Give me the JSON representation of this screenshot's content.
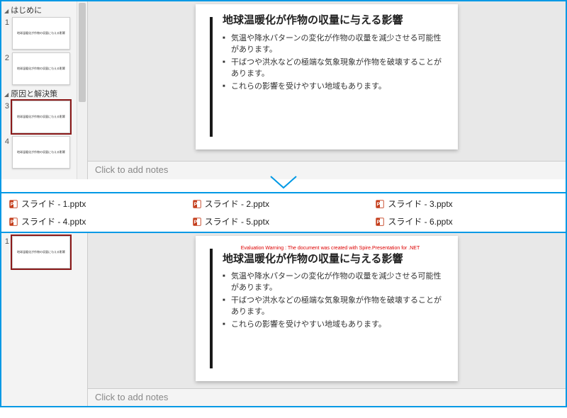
{
  "top": {
    "sections": [
      {
        "label": "はじめに",
        "slides": [
          {
            "num": "1",
            "selected": false
          },
          {
            "num": "2",
            "selected": false
          }
        ]
      },
      {
        "label": "原因と解決策",
        "slides": [
          {
            "num": "3",
            "selected": true
          },
          {
            "num": "4",
            "selected": false
          }
        ]
      }
    ],
    "notes_placeholder": "Click to add notes"
  },
  "slide": {
    "title": "地球温暖化が作物の収量に与える影響",
    "bullets": [
      "気温や降水パターンの変化が作物の収量を減少させる可能性があります。",
      "干ばつや洪水などの極端な気象現象が作物を破壊することがあります。",
      "これらの影響を受けやすい地域もあります。"
    ]
  },
  "files": [
    "スライド - 1.pptx",
    "スライド - 2.pptx",
    "スライド - 3.pptx",
    "スライド - 4.pptx",
    "スライド - 5.pptx",
    "スライド - 6.pptx"
  ],
  "bottom": {
    "thumbs": [
      {
        "num": "1",
        "selected": true
      }
    ],
    "notes_placeholder": "Click to add notes",
    "warning": "Evaluation Warning : The document was created with Spire.Presentation for .NET"
  }
}
